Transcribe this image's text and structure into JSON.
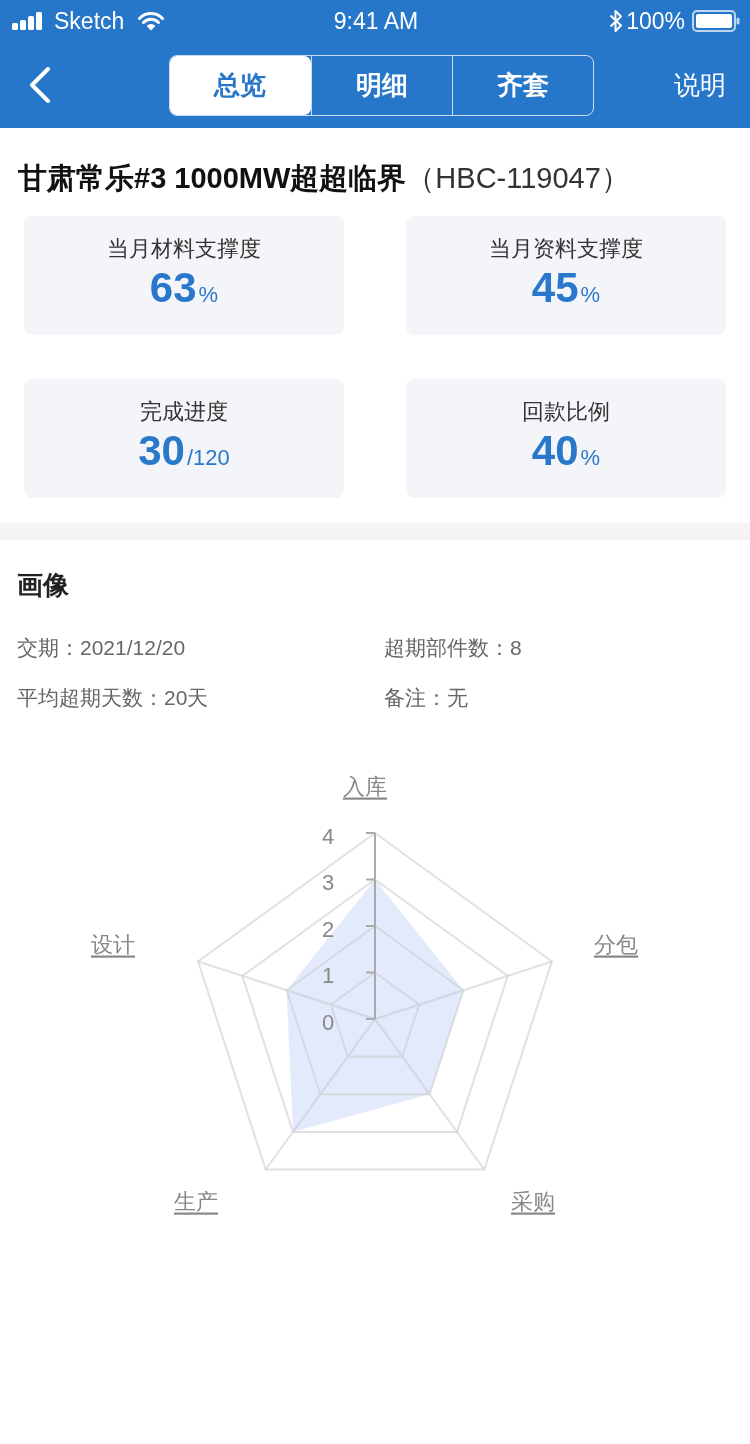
{
  "status_bar": {
    "carrier": "Sketch",
    "time": "9:41 AM",
    "battery": "100%"
  },
  "nav_bar": {
    "tabs": [
      {
        "label": "总览",
        "selected": true
      },
      {
        "label": "明细",
        "selected": false
      },
      {
        "label": "齐套",
        "selected": false
      }
    ],
    "action": "说明"
  },
  "project": {
    "title": "**甘肃常乐#3 1000MW超超临界**（HBC-119047）"
  },
  "metrics": [
    {
      "label": "当月材料支撑度",
      "value": "63",
      "unit": "%"
    },
    {
      "label": "当月资料支撑度",
      "value": "45",
      "unit": "%"
    },
    {
      "label": "完成进度",
      "value": "30",
      "unit": "/120"
    },
    {
      "label": "回款比例",
      "value": "40",
      "unit": "%"
    }
  ],
  "profile": {
    "title": "画像",
    "fields": [
      "交期：2021/12/20",
      "超期部件数：8",
      "平均超期天数：20天",
      "备注：无"
    ],
    "radar": {
      "ticks": [
        "4",
        "3",
        "2",
        "1",
        "0"
      ],
      "axes": [
        {
          "label": "入库",
          "level": 0.75
        },
        {
          "label": "分包",
          "level": 0.5
        },
        {
          "label": "采购",
          "level": 0.5
        },
        {
          "label": "生产",
          "level": 0.75
        },
        {
          "label": "设计",
          "level": 0.5
        }
      ]
    }
  }
}
